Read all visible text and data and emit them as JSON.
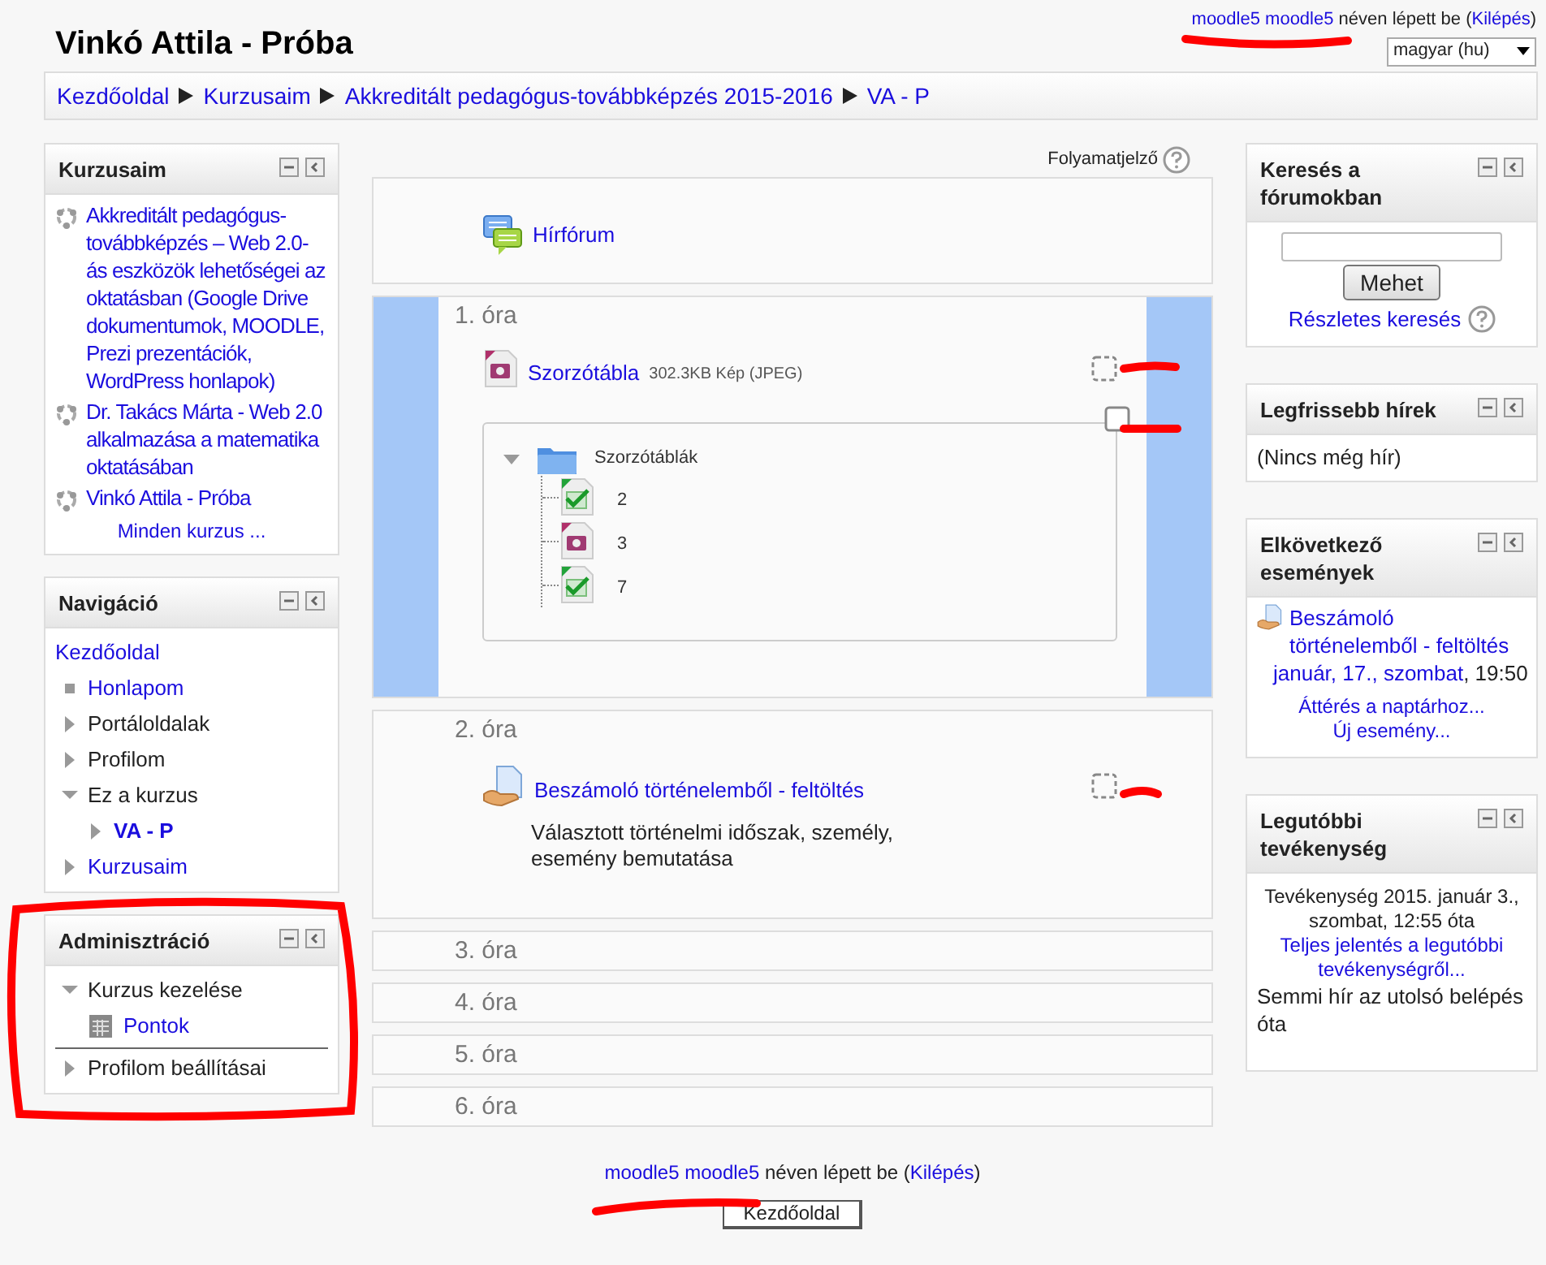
{
  "header": {
    "title": "Vinkó Attila - Próba",
    "login": {
      "user": "moodle5 moodle5",
      "text": "néven lépett be (",
      "logout": "Kilépés",
      "close": ")"
    },
    "language": "magyar (hu)"
  },
  "breadcrumb": [
    "Kezdőoldal",
    "Kurzusaim",
    "Akkreditált pedagógus-továbbképzés 2015-2016",
    "VA - P"
  ],
  "left_blocks": [
    {
      "kind": "courses",
      "title": "Kurzusaim",
      "items": [
        "Akkreditált pedagógus-továbbképzés – Web 2.0-ás eszközök lehetőségei az oktatásban (Google Drive dokumentumok, MOODLE, Prezi prezentációk, WordPress honlapok)",
        "Dr. Takács Márta - Web 2.0 alkalmazása a matematika oktatásában",
        "Vinkó Attila - Próba"
      ],
      "footer": "Minden kurzus ..."
    },
    {
      "kind": "tree",
      "title": "Navigáció",
      "items": [
        {
          "label": "Kezdőoldal",
          "kind": "root",
          "link": true,
          "current": false
        },
        {
          "label": "Honlapom",
          "kind": "leaf",
          "link": true,
          "current": false
        },
        {
          "label": "Portáloldalak",
          "kind": "branch",
          "link": false,
          "expanded": false,
          "current": false
        },
        {
          "label": "Profilom",
          "kind": "branch",
          "link": false,
          "expanded": false,
          "current": false
        },
        {
          "label": "Ez a kurzus",
          "kind": "branch",
          "link": false,
          "expanded": true,
          "current": false,
          "children": [
            {
              "label": "VA - P",
              "kind": "branch",
              "link": true,
              "expanded": false,
              "current": true
            }
          ]
        },
        {
          "label": "Kurzusaim",
          "kind": "branch",
          "link": true,
          "expanded": false,
          "current": false
        }
      ]
    },
    {
      "kind": "tree",
      "title": "Adminisztráció",
      "items": [
        {
          "label": "Kurzus kezelése",
          "kind": "branch",
          "link": false,
          "expanded": true,
          "current": false,
          "children": [
            {
              "label": "Pontok",
              "kind": "grades",
              "link": true,
              "current": false
            }
          ]
        },
        {
          "label": "Profilom beállításai",
          "kind": "branch",
          "link": false,
          "expanded": false,
          "current": false,
          "divider": true
        }
      ]
    }
  ],
  "progress_label": "Folyamatjelző",
  "sections": [
    {
      "highlighted": false,
      "activities": [
        {
          "kind": "forum",
          "name": "Hírfórum"
        }
      ]
    },
    {
      "title": "1. óra",
      "highlighted": true,
      "activities": [
        {
          "kind": "image",
          "name": "Szorzótábla",
          "info": "302.3KB Kép (JPEG)",
          "completion": {
            "kind": "auto",
            "checked": false
          }
        },
        {
          "kind": "folder",
          "completion": {
            "kind": "manual",
            "checked": false
          },
          "folder": {
            "name": "Szorzótáblák",
            "expanded": true,
            "files": [
              {
                "name": "2",
                "kind": "spreadsheet"
              },
              {
                "name": "3",
                "kind": "image"
              },
              {
                "name": "7",
                "kind": "spreadsheet"
              }
            ]
          }
        }
      ]
    },
    {
      "title": "2. óra",
      "highlighted": false,
      "activities": [
        {
          "kind": "assignment",
          "name": "Beszámoló történelemből - feltöltés",
          "completion": {
            "kind": "auto",
            "checked": false
          },
          "description": "Választott történelmi időszak, személy, esemény bemutatása"
        }
      ]
    },
    {
      "title": "3. óra",
      "highlighted": false
    },
    {
      "title": "4. óra",
      "highlighted": false
    },
    {
      "title": "5. óra",
      "highlighted": false
    },
    {
      "title": "6. óra",
      "highlighted": false
    }
  ],
  "right_blocks": [
    {
      "kind": "search",
      "title": "Keresés a fórumokban",
      "button": "Mehet",
      "link": "Részletes keresés"
    },
    {
      "kind": "text",
      "title": "Legfrissebb hírek",
      "text": "(Nincs még hír)"
    },
    {
      "kind": "events",
      "title": "Elkövetkező események",
      "event": {
        "name": "Beszámoló történelemből - feltöltés",
        "date": "január, 17., szombat",
        "time": ", 19:50"
      },
      "links": [
        "Áttérés a naptárhoz...",
        "Új esemény..."
      ]
    },
    {
      "kind": "activity",
      "title": "Legutóbbi tevékenység",
      "since": "Tevékenység 2015. január 3., szombat, 12:55 óta",
      "link": "Teljes jelentés a legutóbbi tevékenységről...",
      "text": "Semmi hír az utolsó belépés óta"
    }
  ],
  "footer": {
    "login": {
      "user": "moodle5 moodle5",
      "text": "néven lépett be (",
      "logout": "Kilépés",
      "close": ")"
    },
    "button": "Kezdőoldal"
  }
}
